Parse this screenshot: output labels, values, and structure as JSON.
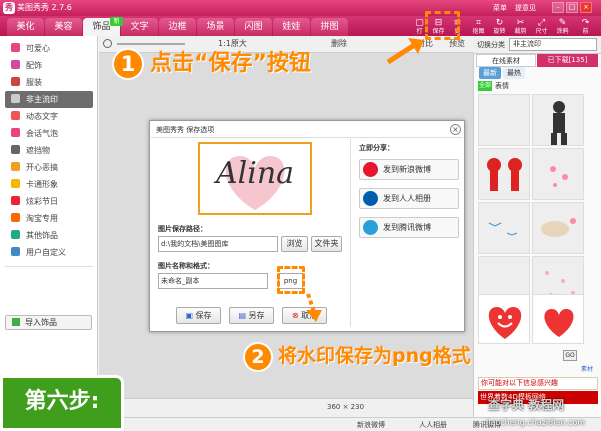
{
  "app": {
    "title": "美图秀秀 2.7.6",
    "logo": "秀"
  },
  "titlebar": {
    "menu": "菜单",
    "feedback": "提意见",
    "min": "–",
    "max": "□",
    "close": "×"
  },
  "tabs": [
    {
      "label": "美化"
    },
    {
      "label": "美容"
    },
    {
      "label": "饰品",
      "active": true
    },
    {
      "label": "文字"
    },
    {
      "label": "边框"
    },
    {
      "label": "场景"
    },
    {
      "label": "闪图"
    },
    {
      "label": "娃娃"
    },
    {
      "label": "拼图"
    }
  ],
  "new_badge": "新",
  "toolbar_icons": [
    {
      "name": "open",
      "glyph": "▢",
      "label": "打"
    },
    {
      "name": "save",
      "glyph": "⊟",
      "label": "保存"
    },
    {
      "name": "more",
      "glyph": "≡",
      "label": "更"
    },
    {
      "name": "crop",
      "glyph": "⌗",
      "label": "抠图"
    },
    {
      "name": "rotate",
      "glyph": "↻",
      "label": "旋转"
    },
    {
      "name": "cut",
      "glyph": "✂",
      "label": "裁剪"
    },
    {
      "name": "size",
      "glyph": "⤢",
      "label": "尺寸"
    },
    {
      "name": "erase",
      "glyph": "✎",
      "label": "涂鸦"
    },
    {
      "name": "redo",
      "glyph": "↷",
      "label": "前"
    }
  ],
  "left_items": [
    {
      "label": "可爱心",
      "color": "#e8467e"
    },
    {
      "label": "配饰",
      "color": "#d24aa0"
    },
    {
      "label": "服装",
      "color": "#c44"
    },
    {
      "label": "非主流印",
      "color": "#999",
      "active": true
    },
    {
      "label": "动态文字",
      "color": "#e55"
    },
    {
      "label": "会话气泡",
      "color": "#e8467e"
    },
    {
      "label": "遮挡物",
      "color": "#666"
    },
    {
      "label": "开心恶搞",
      "color": "#f0a020"
    },
    {
      "label": "卡通形象",
      "color": "#f5b700"
    },
    {
      "label": "炫彩节日",
      "color": "#e23"
    },
    {
      "label": "淘宝专用",
      "color": "#f60"
    },
    {
      "label": "其他饰品",
      "color": "#2a8"
    },
    {
      "label": "用户自定义",
      "color": "#48c"
    }
  ],
  "import_label": "导入饰品",
  "canvas_toolbar": {
    "zoom": "1:1原大",
    "delete": "删除",
    "compare": "对比",
    "preview": "预览"
  },
  "status": {
    "size": "360 × 230"
  },
  "bottombar": {
    "weibo": "新浪微博",
    "renren": "人人相册",
    "tencent": "腾讯微博"
  },
  "right_panel": {
    "category_label": "切换分类",
    "category_value": "非主流印",
    "tab_online": "在线素材",
    "tab_downloaded": "已下载[135]",
    "sub_latest": "最新",
    "sub_hot": "最热",
    "filter_all": "全部",
    "filter_emoji": "表情",
    "go": "GO",
    "more_link": "素材",
    "ad1": "你可能对以下信息感兴趣",
    "ad2": "世界着数4D模板网络"
  },
  "dialog": {
    "title": "美图秀秀 保存选项",
    "close": "×",
    "signature": "Alina",
    "path_label": "图片保存路径：",
    "path_value": "d:\\我的文档\\美图图库",
    "browse": "浏览",
    "folder": "文件夹",
    "name_label": "图片名称和格式：",
    "name_value": "未命名_副本",
    "format": "png",
    "save": "保存",
    "save_as": "另存",
    "cancel": "取消",
    "share_title": "立即分享：",
    "share": [
      {
        "label": "发到新浪微博",
        "color": "#e6162d"
      },
      {
        "label": "发到人人相册",
        "color": "#005eac"
      },
      {
        "label": "发到腾讯微博",
        "color": "#2a9fd8"
      }
    ]
  },
  "annotations": {
    "step1_num": "1",
    "step1_text": "点击“保存”按钮",
    "step2_num": "2",
    "step2_text": "将水印保存为png格式",
    "step_banner": "第六步:",
    "watermark": "查字典 教程网",
    "watermark_url": "jiaocheng.chazidian.com"
  },
  "colors": {
    "accent": "#d2306b",
    "callout": "#ff8a00",
    "step_green": "#3f9e1c"
  }
}
